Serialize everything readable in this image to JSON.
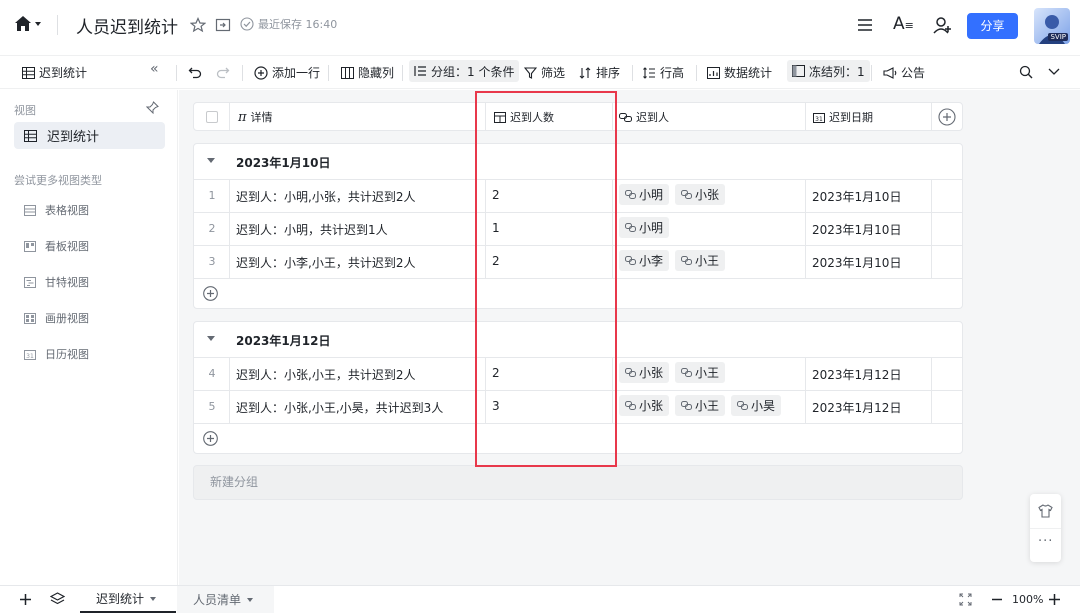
{
  "header": {
    "title": "人员迟到统计",
    "save_status": "最近保存 16:40",
    "share_label": "分享",
    "avatar_badge": "SVIP"
  },
  "toolbar": {
    "view_name": "迟到统计",
    "add_row": "添加一行",
    "hide_columns": "隐藏列",
    "group": "分组：1 个条件",
    "filter": "筛选",
    "sort": "排序",
    "row_height": "行高",
    "data_stats": "数据统计",
    "freeze": "冻结列：1",
    "announcement": "公告"
  },
  "sidebar": {
    "section_views": "视图",
    "active_view": "迟到统计",
    "section_more": "尝试更多视图类型",
    "view_types": [
      {
        "label": "表格视图",
        "icon": "table-view-icon"
      },
      {
        "label": "看板视图",
        "icon": "kanban-view-icon"
      },
      {
        "label": "甘特视图",
        "icon": "gantt-view-icon"
      },
      {
        "label": "画册视图",
        "icon": "gallery-view-icon"
      },
      {
        "label": "日历视图",
        "icon": "calendar-view-icon"
      }
    ]
  },
  "table": {
    "columns": [
      "详情",
      "迟到人数",
      "迟到人",
      "迟到日期"
    ],
    "groups": [
      {
        "title": "2023年1月10日",
        "rows": [
          {
            "num": "1",
            "detail": "迟到人：小明,小张，共计迟到2人",
            "count": "2",
            "people": [
              "小明",
              "小张"
            ],
            "date": "2023年1月10日"
          },
          {
            "num": "2",
            "detail": "迟到人：小明，共计迟到1人",
            "count": "1",
            "people": [
              "小明"
            ],
            "date": "2023年1月10日"
          },
          {
            "num": "3",
            "detail": "迟到人：小李,小王，共计迟到2人",
            "count": "2",
            "people": [
              "小李",
              "小王"
            ],
            "date": "2023年1月10日"
          }
        ]
      },
      {
        "title": "2023年1月12日",
        "rows": [
          {
            "num": "4",
            "detail": "迟到人：小张,小王，共计迟到2人",
            "count": "2",
            "people": [
              "小张",
              "小王"
            ],
            "date": "2023年1月12日"
          },
          {
            "num": "5",
            "detail": "迟到人：小张,小王,小昊，共计迟到3人",
            "count": "3",
            "people": [
              "小张",
              "小王",
              "小昊"
            ],
            "date": "2023年1月12日"
          }
        ]
      }
    ],
    "new_group": "新建分组"
  },
  "bottom": {
    "tabs": [
      "迟到统计",
      "人员清单"
    ],
    "zoom": "100%"
  },
  "colors": {
    "accent": "#3370ff",
    "highlight_box": "#e8384b"
  }
}
